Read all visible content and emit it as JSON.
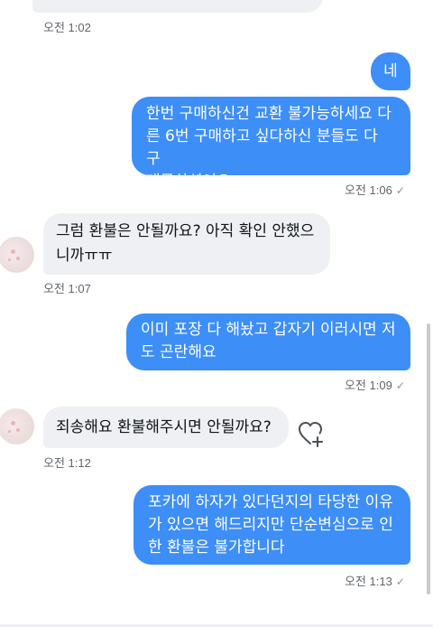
{
  "messages": [
    {
      "sender": "them",
      "text": "",
      "time": "오전 1:02"
    },
    {
      "sender": "me",
      "text": "네",
      "time": ""
    },
    {
      "sender": "me",
      "text": "한번 구매하신건 교환 불가능하세요 다\n른 6번 구매하고 싶다하신 분들도 다 구\n매못하셨어요ㅜ",
      "time": "오전 1:06"
    },
    {
      "sender": "them",
      "text": "그럼 환불은 안될까요? 아직 확인 안했으\n니까ㅠㅠ",
      "time": "오전 1:07"
    },
    {
      "sender": "me",
      "text": "이미 포장 다 해놨고 갑자기 이러시면 저\n도 곤란해요",
      "time": "오전 1:09"
    },
    {
      "sender": "them",
      "text": "죄송해요 환불해주시면 안될까요?",
      "time": "오전 1:12"
    },
    {
      "sender": "me",
      "text": "포카에 하자가 있다던지의 타당한 이유\n가 있으면 해드리지만 단순변심으로 인\n한 환불은 불가합니다",
      "time": "오전 1:13"
    }
  ],
  "icons": {
    "read_check": "✓",
    "react": "heart-plus-icon"
  },
  "colors": {
    "outgoing_bubble": "#3d8ef7",
    "incoming_bubble": "#eef0f3",
    "timestamp": "#60656b"
  }
}
